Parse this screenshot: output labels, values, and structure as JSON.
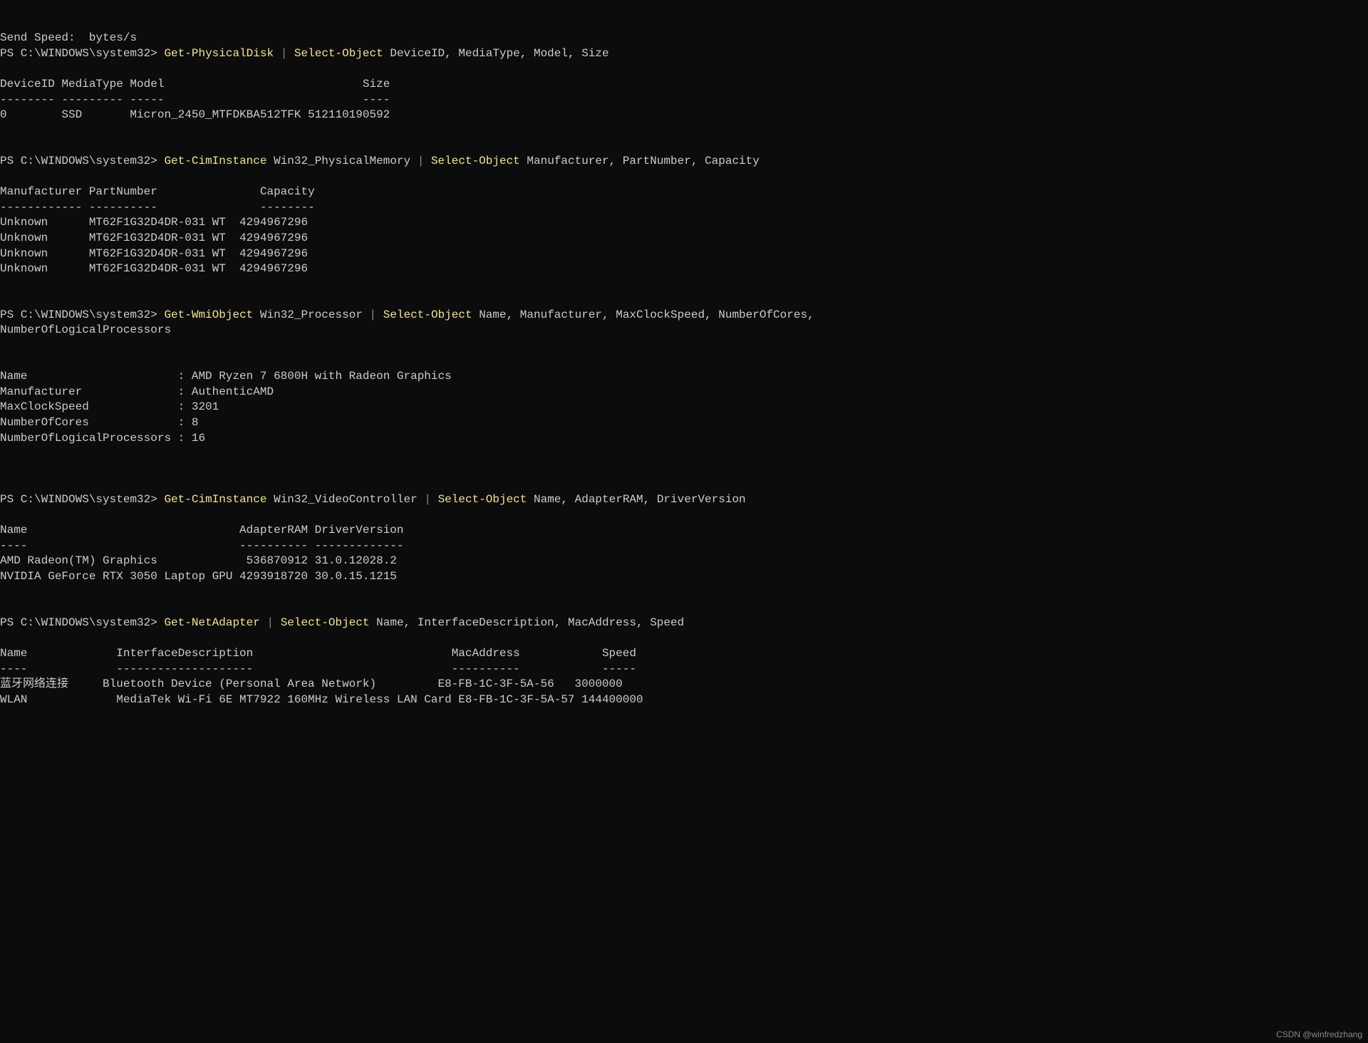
{
  "prompt": "PS C:\\WINDOWS\\system32>",
  "pipe": "|",
  "top": {
    "sendSpeedLabel": "Send Speed:",
    "sendSpeedUnit": "bytes/s"
  },
  "cmd1": {
    "getPhysicalDisk": "Get-PhysicalDisk",
    "selectObject": "Select-Object",
    "props": "DeviceID, MediaType, Model, Size"
  },
  "disk": {
    "header": "DeviceID MediaType Model                             Size",
    "divider": "-------- --------- -----                             ----",
    "rows": [
      "0        SSD       Micron_2450_MTFDKBA512TFK 512110190592"
    ]
  },
  "cmd2": {
    "getCimInstance": "Get-CimInstance",
    "class": "Win32_PhysicalMemory",
    "selectObject": "Select-Object",
    "props": "Manufacturer, PartNumber, Capacity"
  },
  "mem": {
    "header": "Manufacturer PartNumber               Capacity",
    "divider": "------------ ----------               --------",
    "rows": [
      "Unknown      MT62F1G32D4DR-031 WT  4294967296",
      "Unknown      MT62F1G32D4DR-031 WT  4294967296",
      "Unknown      MT62F1G32D4DR-031 WT  4294967296",
      "Unknown      MT62F1G32D4DR-031 WT  4294967296"
    ]
  },
  "cmd3": {
    "getWmiObject": "Get-WmiObject",
    "class": "Win32_Processor",
    "selectObject": "Select-Object",
    "props": "Name, Manufacturer, MaxClockSpeed, NumberOfCores,",
    "props2": "NumberOfLogicalProcessors"
  },
  "cpu": {
    "nameLine": "Name                      : AMD Ryzen 7 6800H with Radeon Graphics",
    "manufacturerLine": "Manufacturer              : AuthenticAMD",
    "maxClockLine": "MaxClockSpeed             : 3201",
    "coresLine": "NumberOfCores             : 8",
    "logicalLine": "NumberOfLogicalProcessors : 16"
  },
  "cmd4": {
    "getCimInstance": "Get-CimInstance",
    "class": "Win32_VideoController",
    "selectObject": "Select-Object",
    "props": "Name, AdapterRAM, DriverVersion"
  },
  "gpu": {
    "header": "Name                               AdapterRAM DriverVersion",
    "divider": "----                               ---------- -------------",
    "rows": [
      "AMD Radeon(TM) Graphics             536870912 31.0.12028.2",
      "NVIDIA GeForce RTX 3050 Laptop GPU 4293918720 30.0.15.1215"
    ]
  },
  "cmd5": {
    "getNetAdapter": "Get-NetAdapter",
    "selectObject": "Select-Object",
    "props": "Name, InterfaceDescription, MacAddress, Speed"
  },
  "net": {
    "header": "Name             InterfaceDescription                             MacAddress            Speed",
    "divider": "----             --------------------                             ----------            -----",
    "rows": [
      "蓝牙网络连接     Bluetooth Device (Personal Area Network)         E8-FB-1C-3F-5A-56   3000000",
      "WLAN             MediaTek Wi-Fi 6E MT7922 160MHz Wireless LAN Card E8-FB-1C-3F-5A-57 144400000"
    ]
  },
  "watermark": "CSDN @winfredzhang"
}
